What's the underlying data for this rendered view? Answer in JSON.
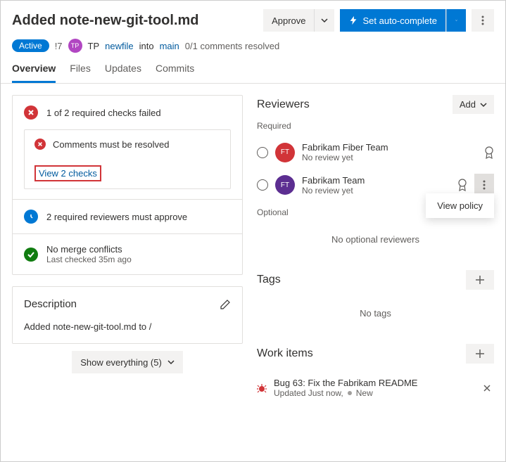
{
  "header": {
    "title": "Added note-new-git-tool.md",
    "approve": "Approve",
    "setAutoComplete": "Set auto-complete"
  },
  "meta": {
    "status": "Active",
    "prId": "!7",
    "avatarInitials": "TP",
    "author": "TP",
    "sourceBranch": "newfile",
    "into": "into",
    "targetBranch": "main",
    "commentsResolved": "0/1 comments resolved"
  },
  "tabs": [
    "Overview",
    "Files",
    "Updates",
    "Commits"
  ],
  "checks": {
    "failed": "1 of 2 required checks failed",
    "commentsMustResolve": "Comments must be resolved",
    "viewChecks": "View 2 checks",
    "reviewersRequired": "2 required reviewers must approve",
    "noMergeConflicts": "No merge conflicts",
    "lastChecked": "Last checked 35m ago"
  },
  "description": {
    "heading": "Description",
    "body": "Added note-new-git-tool.md to /"
  },
  "showEverything": "Show everything (5)",
  "reviewers": {
    "title": "Reviewers",
    "add": "Add",
    "required": "Required",
    "optional": "Optional",
    "noOptional": "No optional reviewers",
    "viewPolicy": "View policy",
    "items": [
      {
        "initials": "FT",
        "name": "Fabrikam Fiber Team",
        "sub": "No review yet",
        "color": "av-red"
      },
      {
        "initials": "FT",
        "name": "Fabrikam Team",
        "sub": "No review yet",
        "color": "av-purple"
      }
    ]
  },
  "tags": {
    "title": "Tags",
    "empty": "No tags"
  },
  "workItems": {
    "title": "Work items",
    "item": {
      "title": "Bug 63: Fix the Fabrikam README",
      "updated": "Updated Just now,",
      "state": "New"
    }
  }
}
